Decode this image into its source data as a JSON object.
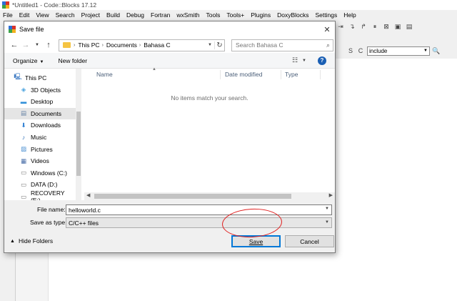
{
  "ide": {
    "title": "*Untitled1 - Code::Blocks 17.12",
    "menu": [
      "File",
      "Edit",
      "View",
      "Search",
      "Project",
      "Build",
      "Debug",
      "Fortran",
      "wxSmith",
      "Tools",
      "Tools+",
      "Plugins",
      "DoxyBlocks",
      "Settings",
      "Help"
    ],
    "combo_value": "include"
  },
  "dialog": {
    "title": "Save file",
    "breadcrumb": [
      "This PC",
      "Documents",
      "Bahasa C"
    ],
    "search_placeholder": "Search Bahasa C",
    "organize_label": "Organize",
    "new_folder_label": "New folder",
    "nav_items": [
      {
        "label": "This PC",
        "icon": "computer-icon"
      },
      {
        "label": "3D Objects",
        "icon": "cube-icon"
      },
      {
        "label": "Desktop",
        "icon": "desktop-icon"
      },
      {
        "label": "Documents",
        "icon": "document-icon",
        "selected": true
      },
      {
        "label": "Downloads",
        "icon": "download-icon"
      },
      {
        "label": "Music",
        "icon": "music-icon"
      },
      {
        "label": "Pictures",
        "icon": "picture-icon"
      },
      {
        "label": "Videos",
        "icon": "video-icon"
      },
      {
        "label": "Windows (C:)",
        "icon": "drive-icon"
      },
      {
        "label": "DATA (D:)",
        "icon": "drive-icon"
      },
      {
        "label": "RECOVERY (E:)",
        "icon": "drive-icon"
      }
    ],
    "columns": {
      "name": "Name",
      "date": "Date modified",
      "type": "Type"
    },
    "empty_message": "No items match your search.",
    "filename_label": "File name:",
    "filename_value": "helloworld.c",
    "savetype_label": "Save as type:",
    "savetype_value": "C/C++ files",
    "hide_folders_label": "Hide Folders",
    "save_label": "Save",
    "cancel_label": "Cancel"
  },
  "colors": {
    "annotation": "#e02020",
    "accent": "#0078d7"
  }
}
